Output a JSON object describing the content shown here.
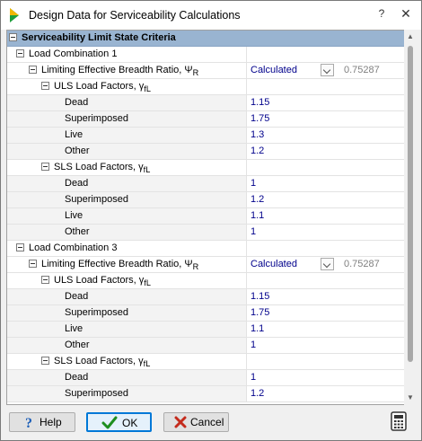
{
  "window": {
    "title": "Design Data for Serviceability Calculations",
    "help_symbol": "?",
    "close_symbol": "✕"
  },
  "header": {
    "label": "Serviceability Limit State Criteria"
  },
  "combo1": {
    "label": "Load Combination 1",
    "ratio_label": "Limiting Effective Breadth Ratio, ",
    "ratio_symbol": "Ψ",
    "ratio_sub": "R",
    "ratio_value": "Calculated",
    "ratio_number": "0.75287",
    "uls": {
      "label": "ULS Load Factors, ",
      "symbol": "γ",
      "sub": "fL",
      "rows": [
        {
          "name": "Dead",
          "value": "1.15"
        },
        {
          "name": "Superimposed",
          "value": "1.75"
        },
        {
          "name": "Live",
          "value": "1.3"
        },
        {
          "name": "Other",
          "value": "1.2"
        }
      ]
    },
    "sls": {
      "label": "SLS Load Factors, ",
      "symbol": "γ",
      "sub": "fL",
      "rows": [
        {
          "name": "Dead",
          "value": "1"
        },
        {
          "name": "Superimposed",
          "value": "1.2"
        },
        {
          "name": "Live",
          "value": "1.1"
        },
        {
          "name": "Other",
          "value": "1"
        }
      ]
    }
  },
  "combo3": {
    "label": "Load Combination 3",
    "ratio_label": "Limiting Effective Breadth Ratio, ",
    "ratio_symbol": "Ψ",
    "ratio_sub": "R",
    "ratio_value": "Calculated",
    "ratio_number": "0.75287",
    "uls": {
      "label": "ULS Load Factors, ",
      "symbol": "γ",
      "sub": "fL",
      "rows": [
        {
          "name": "Dead",
          "value": "1.15"
        },
        {
          "name": "Superimposed",
          "value": "1.75"
        },
        {
          "name": "Live",
          "value": "1.1"
        },
        {
          "name": "Other",
          "value": "1"
        }
      ]
    },
    "sls": {
      "label": "SLS Load Factors, ",
      "symbol": "γ",
      "sub": "fL",
      "rows": [
        {
          "name": "Dead",
          "value": "1"
        },
        {
          "name": "Superimposed",
          "value": "1.2"
        }
      ]
    }
  },
  "buttons": {
    "help": "Help",
    "ok": "OK",
    "cancel": "Cancel"
  },
  "colors": {
    "value_text": "#00008b",
    "header_bg": "#99b4d1",
    "ok_border": "#0078d7",
    "cancel_x": "#c42b1c",
    "ok_check": "#1e8e1e"
  }
}
